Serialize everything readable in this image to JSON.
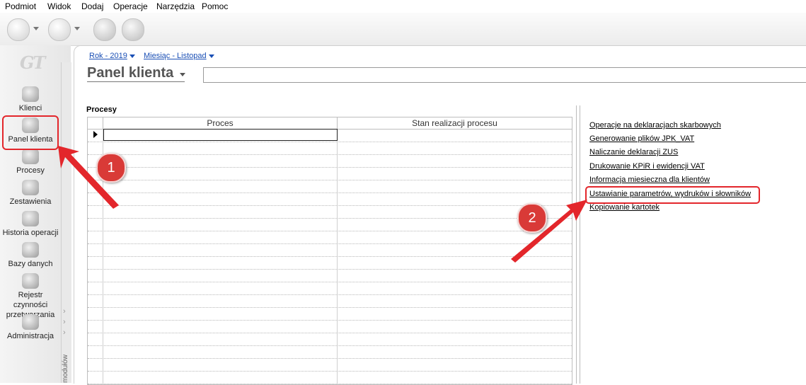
{
  "menu": [
    "Podmiot",
    "Widok",
    "Dodaj",
    "Operacje",
    "Narzędzia",
    "Pomoc"
  ],
  "toolbar": {
    "buttons": [
      "back-icon",
      "forward-icon",
      "tools-icon",
      "settings-icon"
    ]
  },
  "sidebar": {
    "logo": "GT",
    "items": [
      {
        "label": "Klienci",
        "icon": "clients-icon"
      },
      {
        "label": "Panel klienta",
        "icon": "client-panel-icon",
        "active": true
      },
      {
        "label": "Procesy",
        "icon": "gears-icon"
      },
      {
        "label": "Zestawienia",
        "icon": "reports-icon"
      },
      {
        "label": "Historia operacji",
        "icon": "history-icon"
      },
      {
        "label": "Bazy danych",
        "icon": "database-icon"
      },
      {
        "label": "Rejestr czynności przetwarzania",
        "icon": "register-icon"
      },
      {
        "label": "Administracja",
        "icon": "admin-icon"
      }
    ],
    "modules_label": "modułów"
  },
  "main": {
    "year_selector": "Rok - 2019",
    "month_selector": "Miesiąc - Listopad",
    "title": "Panel klienta",
    "search_value": "",
    "processes_label": "Procesy",
    "grid": {
      "columns": [
        "Proces",
        "Stan realizacji procesu"
      ],
      "rows": []
    },
    "links": [
      "Operacje na deklaracjach skarbowych",
      "Generowanie plików JPK_VAT",
      "Naliczanie deklaracji ZUS",
      "Drukowanie KPiR i ewidencji VAT",
      "Informacja miesieczna dla klientów",
      "Ustawianie parametrów, wydruków i słowników",
      "Kopiowanie kartotek"
    ],
    "highlighted_link": "Ustawianie parametrów, wydruków i słowników"
  },
  "annotations": {
    "badge_1": "1",
    "badge_2": "2",
    "color": "#d93a37"
  }
}
